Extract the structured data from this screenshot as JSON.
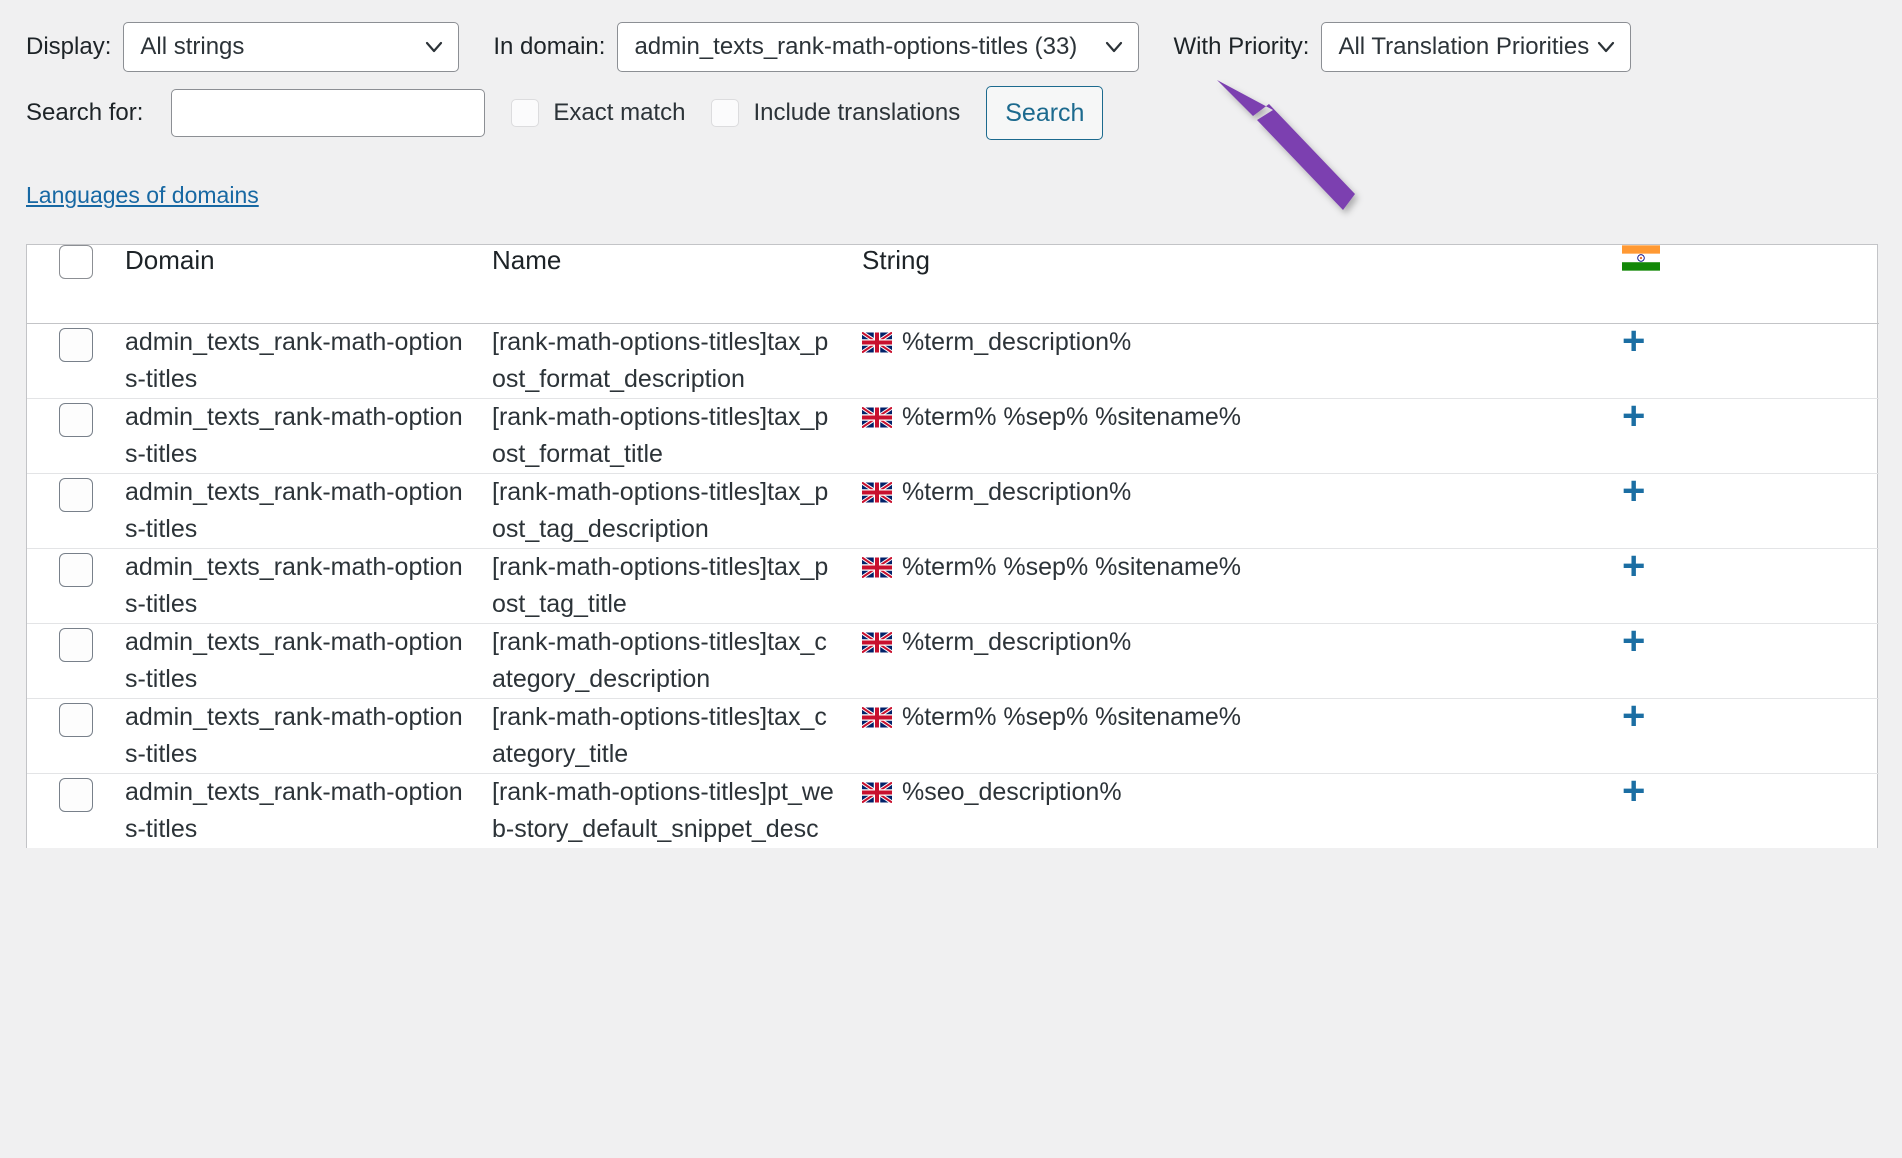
{
  "filters": {
    "display_label": "Display:",
    "display_value": "All strings",
    "domain_label": "In domain:",
    "domain_value": "admin_texts_rank-math-options-titles (33)",
    "priority_label": "With Priority:",
    "priority_value": "All Translation Priorities",
    "search_label": "Search for:",
    "search_value": "",
    "search_placeholder": "",
    "exact_match_label": "Exact match",
    "include_translations_label": "Include translations",
    "search_button_label": "Search",
    "languages_of_domains_link": "Languages of domains"
  },
  "table": {
    "headers": {
      "domain": "Domain",
      "name": "Name",
      "string": "String",
      "language_flag": "india-flag-icon"
    },
    "rows": [
      {
        "domain": "admin_texts_rank-math-options-titles",
        "name": "[rank-math-options-titles]tax_post_format_description",
        "string": "%term_description%",
        "string_flag": "uk-flag-icon",
        "add_action": "+"
      },
      {
        "domain": "admin_texts_rank-math-options-titles",
        "name": "[rank-math-options-titles]tax_post_format_title",
        "string": "%term% %sep% %sitename%",
        "string_flag": "uk-flag-icon",
        "add_action": "+"
      },
      {
        "domain": "admin_texts_rank-math-options-titles",
        "name": "[rank-math-options-titles]tax_post_tag_description",
        "string": "%term_description%",
        "string_flag": "uk-flag-icon",
        "add_action": "+"
      },
      {
        "domain": "admin_texts_rank-math-options-titles",
        "name": "[rank-math-options-titles]tax_post_tag_title",
        "string": "%term% %sep% %sitename%",
        "string_flag": "uk-flag-icon",
        "add_action": "+"
      },
      {
        "domain": "admin_texts_rank-math-options-titles",
        "name": "[rank-math-options-titles]tax_category_description",
        "string": "%term_description%",
        "string_flag": "uk-flag-icon",
        "add_action": "+"
      },
      {
        "domain": "admin_texts_rank-math-options-titles",
        "name": "[rank-math-options-titles]tax_category_title",
        "string": "%term% %sep% %sitename%",
        "string_flag": "uk-flag-icon",
        "add_action": "+"
      },
      {
        "domain": "admin_texts_rank-math-options-titles",
        "name": "[rank-math-options-titles]pt_web-story_default_snippet_desc",
        "string": "%seo_description%",
        "string_flag": "uk-flag-icon",
        "add_action": "+"
      }
    ]
  },
  "annotation": {
    "type": "arrow-pointer",
    "color": "#7b3fb0",
    "points_to": "domain-select"
  },
  "colors": {
    "page_background": "#f0f0f1",
    "table_background": "#ffffff",
    "border": "#c3c4c7",
    "link": "#1768a3",
    "button_accent": "#1c6a8e",
    "plus_icon": "#1b6ea3",
    "annotation_purple": "#7b3fb0"
  }
}
